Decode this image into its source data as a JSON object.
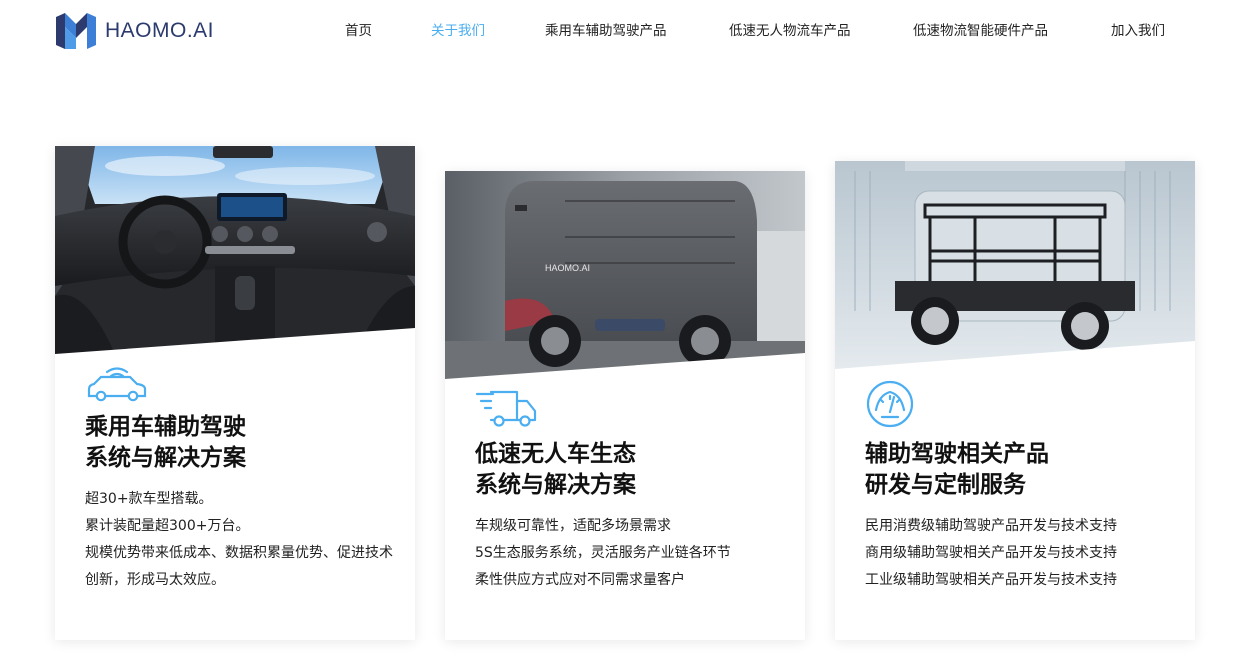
{
  "brand": {
    "name": "HAOMO.AI",
    "logo_icon": "haomo-logo-icon",
    "colors": {
      "dark": "#2c3a6e",
      "light": "#3d7fd6"
    }
  },
  "nav": {
    "accent_color": "#4aaef0",
    "items": [
      {
        "label": "首页",
        "active": false
      },
      {
        "label": "关于我们",
        "active": true
      },
      {
        "label": "乘用车辅助驾驶产品",
        "active": false
      },
      {
        "label": "低速无人物流车产品",
        "active": false
      },
      {
        "label": "低速物流智能硬件产品",
        "active": false
      },
      {
        "label": "加入我们",
        "active": false
      }
    ]
  },
  "cards": [
    {
      "image": "car-interior-dashboard-photo",
      "icon": "connected-car-icon",
      "title_line1": "乘用车辅助驾驶",
      "title_line2": "系统与解决方案",
      "lines": [
        "超30+款车型搭载。",
        "累计装配量超300+万台。",
        "规模优势带来低成本、数据积累量优势、促进技术创新，形成马太效应。"
      ]
    },
    {
      "image": "delivery-vehicle-photo",
      "image_text": "HAOMO.AI",
      "icon": "delivery-truck-icon",
      "title_line1": "低速无人车生态",
      "title_line2": "系统与解决方案",
      "lines": [
        "车规级可靠性，适配多场景需求",
        "5S生态服务系统，灵活服务产业链各环节",
        "柔性供应方式应对不同需求量客户"
      ]
    },
    {
      "image": "vehicle-chassis-photo",
      "icon": "speedometer-icon",
      "title_line1": "辅助驾驶相关产品",
      "title_line2": "研发与定制服务",
      "lines": [
        "民用消费级辅助驾驶产品开发与技术支持",
        "商用级辅助驾驶相关产品开发与技术支持",
        "工业级辅助驾驶相关产品开发与技术支持"
      ]
    }
  ]
}
